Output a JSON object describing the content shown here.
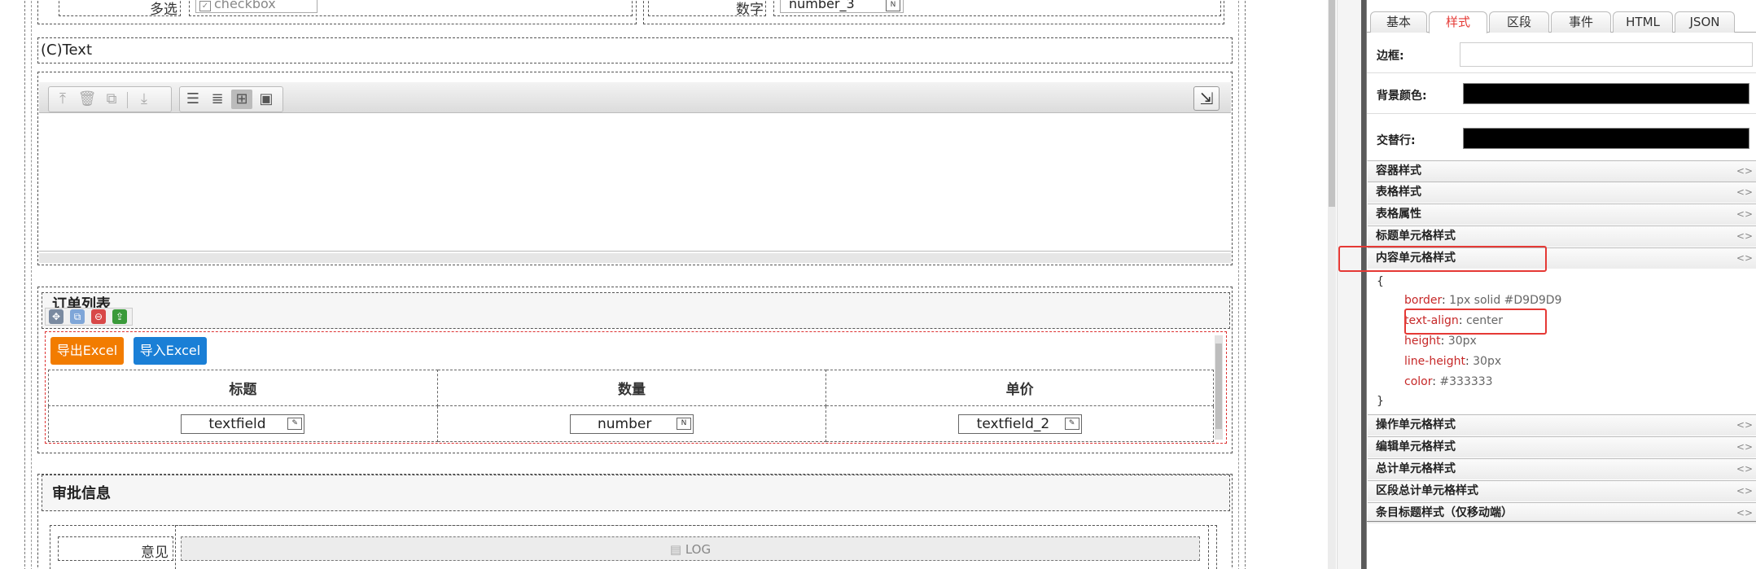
{
  "form": {
    "row1": {
      "multi_label": "多选",
      "checkbox_value": "checkbox",
      "number_label": "数字",
      "number_value": "number_3"
    },
    "ctext": "(C)Text",
    "order": {
      "title": "订单列表",
      "export_btn": "导出Excel",
      "import_btn": "导入Excel",
      "headers": [
        "标题",
        "数量",
        "单价"
      ],
      "row": [
        "textfield",
        "number",
        "textfield_2"
      ]
    },
    "approve": {
      "title": "审批信息",
      "opinion_label": "意见",
      "log_text": "LOG"
    }
  },
  "panel": {
    "tabs": [
      "基本",
      "样式",
      "区段",
      "事件",
      "HTML",
      "JSON"
    ],
    "active_tab": "样式",
    "props": {
      "border_label": "边框:",
      "bg_label": "背景颜色:",
      "alt_label": "交替行:",
      "bg_color": "#000000",
      "alt_color": "#000000"
    },
    "sections_top": [
      "容器样式",
      "表格样式",
      "表格属性",
      "标题单元格样式",
      "内容单元格样式"
    ],
    "code": {
      "open": "{",
      "close": "}",
      "lines": [
        {
          "key": "border",
          "value": "1px solid #D9D9D9"
        },
        {
          "key": "text-align",
          "value": "center"
        },
        {
          "key": "height",
          "value": "30px"
        },
        {
          "key": "line-height",
          "value": "30px"
        },
        {
          "key": "color",
          "value": "#333333"
        }
      ]
    },
    "sections_bottom": [
      "操作单元格样式",
      "编辑单元格样式",
      "总计单元格样式",
      "区段总计单元格样式",
      "条目标题样式（仅移动端）"
    ],
    "arrow": "<>",
    "colon": ":",
    "highlight_color": "#e53935"
  }
}
